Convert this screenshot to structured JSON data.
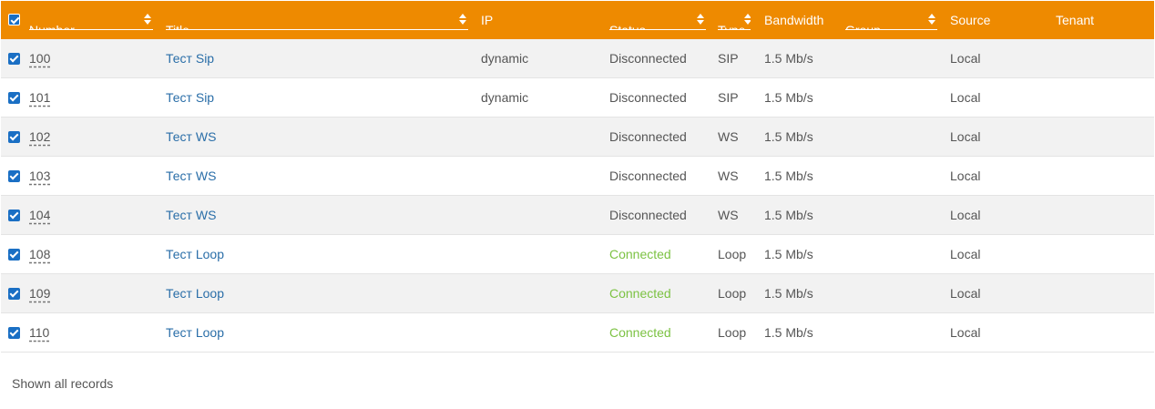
{
  "header": {
    "number": "Number",
    "title": "Title",
    "ip": "IP",
    "status": "Status",
    "type": "Type",
    "bandwidth": "Bandwidth",
    "group": "Group",
    "source": "Source",
    "tenant": "Tenant"
  },
  "colors": {
    "header_bg": "#ee8a00",
    "link": "#2a6ea8",
    "connected": "#7cc243",
    "checkbox": "#1a6fc4"
  },
  "rows": [
    {
      "number": "100",
      "title": "Тест Sip",
      "ip": "dynamic",
      "status": "Disconnected",
      "type": "SIP",
      "bandwidth": "1.5 Mb/s",
      "group": "",
      "source": "Local",
      "tenant": ""
    },
    {
      "number": "101",
      "title": "Тест Sip",
      "ip": "dynamic",
      "status": "Disconnected",
      "type": "SIP",
      "bandwidth": "1.5 Mb/s",
      "group": "",
      "source": "Local",
      "tenant": ""
    },
    {
      "number": "102",
      "title": "Тест WS",
      "ip": "",
      "status": "Disconnected",
      "type": "WS",
      "bandwidth": "1.5 Mb/s",
      "group": "",
      "source": "Local",
      "tenant": ""
    },
    {
      "number": "103",
      "title": "Тест WS",
      "ip": "",
      "status": "Disconnected",
      "type": "WS",
      "bandwidth": "1.5 Mb/s",
      "group": "",
      "source": "Local",
      "tenant": ""
    },
    {
      "number": "104",
      "title": "Тест WS",
      "ip": "",
      "status": "Disconnected",
      "type": "WS",
      "bandwidth": "1.5 Mb/s",
      "group": "",
      "source": "Local",
      "tenant": ""
    },
    {
      "number": "108",
      "title": "Тест Loop",
      "ip": "",
      "status": "Connected",
      "type": "Loop",
      "bandwidth": "1.5 Mb/s",
      "group": "",
      "source": "Local",
      "tenant": ""
    },
    {
      "number": "109",
      "title": "Тест Loop",
      "ip": "",
      "status": "Connected",
      "type": "Loop",
      "bandwidth": "1.5 Mb/s",
      "group": "",
      "source": "Local",
      "tenant": ""
    },
    {
      "number": "110",
      "title": "Тест Loop",
      "ip": "",
      "status": "Connected",
      "type": "Loop",
      "bandwidth": "1.5 Mb/s",
      "group": "",
      "source": "Local",
      "tenant": ""
    }
  ],
  "footer": {
    "text": "Shown all records"
  }
}
